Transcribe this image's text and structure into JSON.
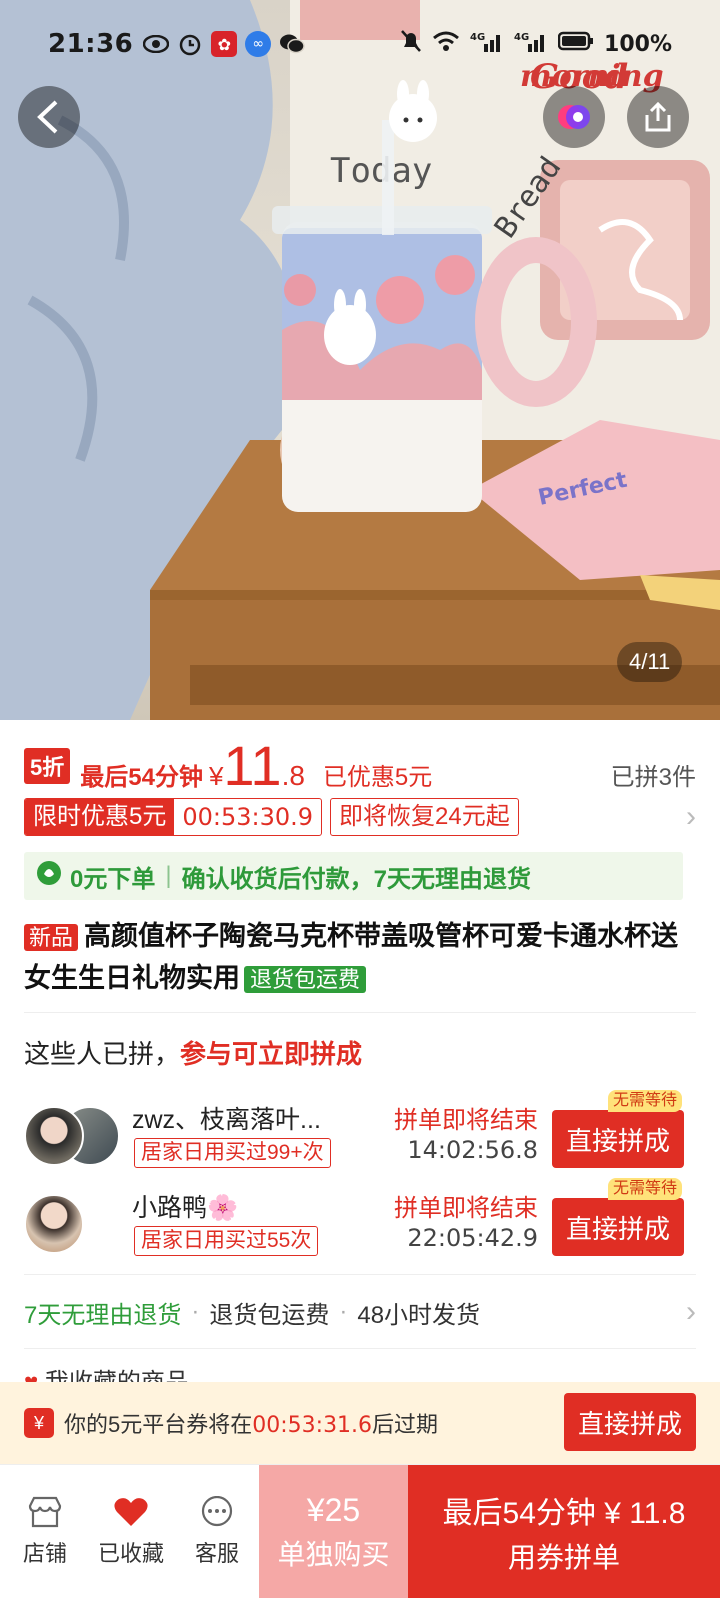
{
  "status_bar": {
    "time": "21:36",
    "battery": "100%"
  },
  "hero": {
    "image_counter": "4/11",
    "photo_text_top": "Good",
    "photo_text_bottom": "morning",
    "photo_handwriting": "Today",
    "photo_bread": "Bread",
    "photo_notebook": "Perfect"
  },
  "price": {
    "discount_badge": "5折",
    "countdown_label": "最后54分钟",
    "currency": "¥",
    "price_int": "11",
    "price_dec": ".8",
    "saved": "已优惠5元",
    "grouped_count": "已拼3件"
  },
  "promo": {
    "label": "限时优惠5元",
    "timer": "00:53:30.9",
    "restore": "即将恢复24元起"
  },
  "zero_order": {
    "text1": "0元下单",
    "text2": "确认收货后付款，7天无理由退货"
  },
  "product": {
    "new_tag": "新品",
    "title": "高颜值杯子陶瓷马克杯带盖吸管杯可爱卡通水杯送女生生日礼物实用",
    "return_tag": "退货包运费"
  },
  "join": {
    "head_text": "这些人已拼，",
    "head_highlight": "参与可立即拼成",
    "groups": [
      {
        "name": "zwz、枝离落叶...",
        "badge": "居家日用买过99+次",
        "ending": "拼单即将结束",
        "timer": "14:02:56.8",
        "button": "直接拼成",
        "no_wait": "无需等待"
      },
      {
        "name": "小路鸭🌸",
        "badge": "居家日用买过55次",
        "ending": "拼单即将结束",
        "timer": "22:05:42.9",
        "button": "直接拼成",
        "no_wait": "无需等待"
      }
    ]
  },
  "service": {
    "item1": "7天无理由退货",
    "item2": "退货包运费",
    "item3": "48小时发货"
  },
  "favorites_peek": "我收藏的商品",
  "coupon": {
    "prefix": "你的5元平台券将在",
    "timer": "00:53:31.6",
    "suffix": "后过期",
    "button": "直接拼成"
  },
  "bottom": {
    "store": "店铺",
    "favorited": "已收藏",
    "service": "客服",
    "single_price": "¥25",
    "single_label": "单独购买",
    "group_price": "最后54分钟 ¥ 11.8",
    "group_label": "用券拼单"
  },
  "colors": {
    "accent": "#e02e24",
    "green": "#2f9d3a",
    "coupon_bg": "#fff3dd"
  }
}
